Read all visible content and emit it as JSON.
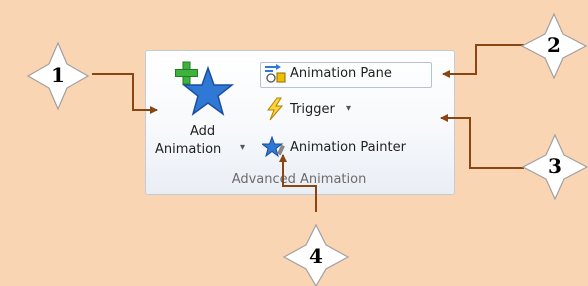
{
  "ribbon": {
    "group_label": "Advanced Animation",
    "add_animation": {
      "line1": "Add",
      "line2": "Animation",
      "dropdown": "▾",
      "icon": "star-plus-icon"
    },
    "animation_pane": {
      "label": "Animation Pane",
      "icon": "animation-pane-icon"
    },
    "trigger": {
      "label": "Trigger",
      "dropdown": "▾",
      "icon": "lightning-icon"
    },
    "animation_painter": {
      "label": "Animation Painter",
      "icon": "painter-star-icon"
    }
  },
  "callouts": [
    {
      "number": "1"
    },
    {
      "number": "2"
    },
    {
      "number": "3"
    },
    {
      "number": "4"
    }
  ],
  "colors": {
    "background": "#fad5b3",
    "arrow": "#8b4513",
    "star_blue": "#2f78d6",
    "plus_green": "#3db33d"
  }
}
